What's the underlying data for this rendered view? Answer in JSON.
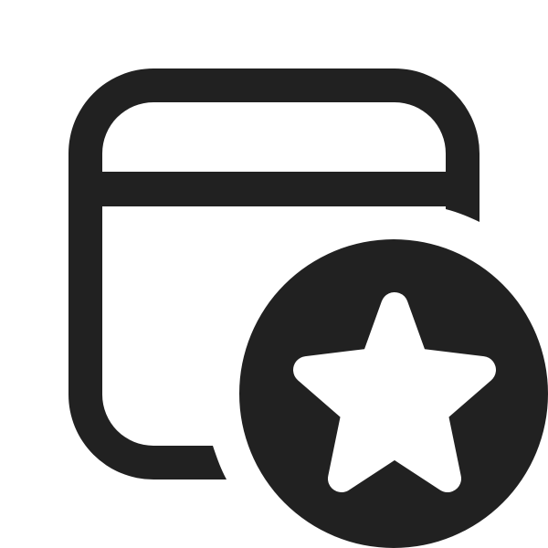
{
  "icon": {
    "name": "calendar-star-icon",
    "colors": {
      "foreground": "#212121",
      "background": "#ffffff"
    }
  }
}
